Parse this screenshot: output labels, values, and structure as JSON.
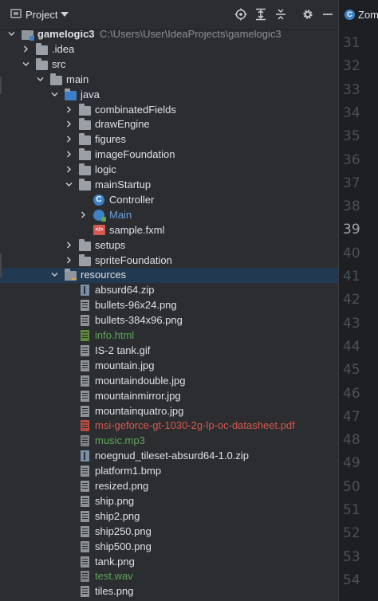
{
  "toolbar": {
    "title": "Project",
    "icons": [
      "locate-icon",
      "expand-all-icon",
      "collapse-all-icon",
      "gear-icon",
      "minimize-icon"
    ]
  },
  "editor_tab": {
    "label": "Zom",
    "icon": "class-icon"
  },
  "gutter": {
    "lines": [
      "31",
      "32",
      "33",
      "34",
      "35",
      "36",
      "37",
      "38",
      "39",
      "40",
      "41",
      "42",
      "43",
      "44",
      "45",
      "46",
      "47",
      "48",
      "49",
      "50",
      "51",
      "52",
      "53",
      "54"
    ],
    "current": "39"
  },
  "tree": [
    {
      "label": "gamelogic3",
      "path": "C:\\Users\\User\\IdeaProjects\\gamelogic3",
      "icon": "module-folder-icon",
      "depth": 0,
      "chevron": "down",
      "style": "bold"
    },
    {
      "label": ".idea",
      "icon": "folder-icon",
      "depth": 1,
      "chevron": "right"
    },
    {
      "label": "src",
      "icon": "folder-icon",
      "depth": 1,
      "chevron": "down"
    },
    {
      "label": "main",
      "icon": "folder-icon",
      "depth": 2,
      "chevron": "down"
    },
    {
      "label": "java",
      "icon": "source-folder-icon",
      "depth": 3,
      "chevron": "down"
    },
    {
      "label": "combinatedFields",
      "icon": "folder-icon",
      "depth": 4,
      "chevron": "right"
    },
    {
      "label": "drawEngine",
      "icon": "folder-icon",
      "depth": 4,
      "chevron": "right"
    },
    {
      "label": "figures",
      "icon": "folder-icon",
      "depth": 4,
      "chevron": "right"
    },
    {
      "label": "imageFoundation",
      "icon": "folder-icon",
      "depth": 4,
      "chevron": "right"
    },
    {
      "label": "logic",
      "icon": "folder-icon",
      "depth": 4,
      "chevron": "right"
    },
    {
      "label": "mainStartup",
      "icon": "folder-icon",
      "depth": 4,
      "chevron": "down"
    },
    {
      "label": "Controller",
      "icon": "class-icon",
      "depth": 5,
      "chevron": "none"
    },
    {
      "label": "Main",
      "icon": "main-class-icon",
      "depth": 5,
      "chevron": "right",
      "style": "blue"
    },
    {
      "label": "sample.fxml",
      "icon": "fxml-icon",
      "depth": 5,
      "chevron": "none"
    },
    {
      "label": "setups",
      "icon": "folder-icon",
      "depth": 4,
      "chevron": "right"
    },
    {
      "label": "spriteFoundation",
      "icon": "folder-icon",
      "depth": 4,
      "chevron": "right"
    },
    {
      "label": "resources",
      "icon": "resources-folder-icon",
      "depth": 3,
      "chevron": "down",
      "selected": true
    },
    {
      "label": "absurd64.zip",
      "icon": "zip-file-icon",
      "depth": 4,
      "chevron": "none"
    },
    {
      "label": "bullets-96x24.png",
      "icon": "image-file-icon",
      "depth": 4,
      "chevron": "none"
    },
    {
      "label": "bullets-384x96.png",
      "icon": "image-file-icon",
      "depth": 4,
      "chevron": "none"
    },
    {
      "label": "info.html",
      "icon": "html-file-icon",
      "depth": 4,
      "chevron": "none",
      "style": "green"
    },
    {
      "label": "IS-2 tank.gif",
      "icon": "image-file-icon",
      "depth": 4,
      "chevron": "none"
    },
    {
      "label": "mountain.jpg",
      "icon": "image-file-icon",
      "depth": 4,
      "chevron": "none"
    },
    {
      "label": "mountaindouble.jpg",
      "icon": "image-file-icon",
      "depth": 4,
      "chevron": "none"
    },
    {
      "label": "mountainmirror.jpg",
      "icon": "image-file-icon",
      "depth": 4,
      "chevron": "none"
    },
    {
      "label": "mountainquatro.jpg",
      "icon": "image-file-icon",
      "depth": 4,
      "chevron": "none"
    },
    {
      "label": "msi-geforce-gt-1030-2g-lp-oc-datasheet.pdf",
      "icon": "pdf-file-icon",
      "depth": 4,
      "chevron": "none",
      "style": "red"
    },
    {
      "label": "music.mp3",
      "icon": "audio-file-icon",
      "depth": 4,
      "chevron": "none",
      "style": "green"
    },
    {
      "label": "noegnud_tileset-absurd64-1.0.zip",
      "icon": "zip-file-icon",
      "depth": 4,
      "chevron": "none"
    },
    {
      "label": "platform1.bmp",
      "icon": "image-file-icon",
      "depth": 4,
      "chevron": "none"
    },
    {
      "label": "resized.png",
      "icon": "image-file-icon",
      "depth": 4,
      "chevron": "none"
    },
    {
      "label": "ship.png",
      "icon": "image-file-icon",
      "depth": 4,
      "chevron": "none"
    },
    {
      "label": "ship2.png",
      "icon": "image-file-icon",
      "depth": 4,
      "chevron": "none"
    },
    {
      "label": "ship250.png",
      "icon": "image-file-icon",
      "depth": 4,
      "chevron": "none"
    },
    {
      "label": "ship500.png",
      "icon": "image-file-icon",
      "depth": 4,
      "chevron": "none"
    },
    {
      "label": "tank.png",
      "icon": "image-file-icon",
      "depth": 4,
      "chevron": "none"
    },
    {
      "label": "test.wav",
      "icon": "audio-file-icon",
      "depth": 4,
      "chevron": "none",
      "style": "green"
    },
    {
      "label": "tiles.png",
      "icon": "image-file-icon",
      "depth": 4,
      "chevron": "none"
    }
  ]
}
